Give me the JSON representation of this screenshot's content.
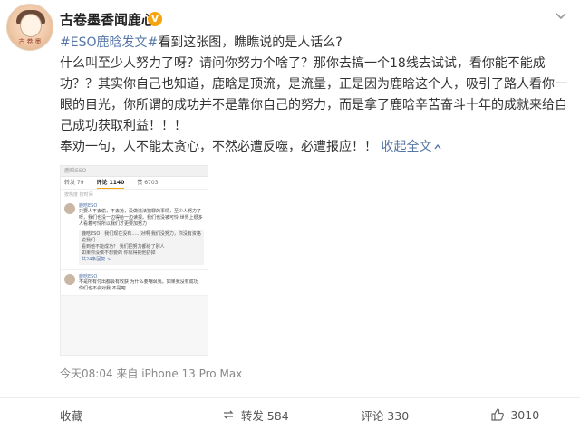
{
  "header": {
    "username": "古卷墨香闻鹿心",
    "verified_mark": "V",
    "avatar_seal": "古卷墨"
  },
  "post": {
    "topic": "#ESO鹿晗发文#",
    "lines": [
      "看到这张图，瞧瞧说的是人话么?",
      "什么叫至少人努力了呀？请问你努力个啥了？那你去搞一个18线去试试，看你能不能成功？？其实你自己也知道，鹿晗是顶流，是流量，正是因为鹿晗这个人，吸引了路人看你一眼的目光，你所谓的成功并不是靠你自己的努力，而是拿了鹿晗辛苦奋斗十年的成就来给自己成功获取利益！！！",
      "奉劝一句，人不能太贪心，不然必遭反噬，必遭报应！！"
    ],
    "expand_label": "收起全文",
    "expand_icon": "chevron-up-icon"
  },
  "embed": {
    "top_bar": "鹿晗ESO",
    "stats": [
      "转发 79",
      "评论 1140",
      "赞 6703"
    ],
    "sub": "按热度 按时间",
    "comments": [
      {
        "name": "鹿晗ESO",
        "body": "只要人不去偷，不去抢，没做违法犯罪的事情，至少人努力了呀，我们也没一边得给一边读报。我们也没被可怜 世界上很多人看着可怜所以我们才更要加努力",
        "replies": [
          "鹿晗ESO：我们现在没有……对啊 我们没努力，你没有资格说我们",
          "看到他不能成功？ 我们把努力都给了别人",
          "如果你没做不想要的 你就得把他扔掉"
        ],
        "link": "共24条回复 >"
      },
      {
        "name": "鹿晗ESO",
        "body": "不是所有付出都会有收获 为什么要嘲讽我，如果我没有成功 你们也不会对我 不是吧",
        "replies": [],
        "link": ""
      }
    ]
  },
  "meta": {
    "time_source": "今天08:04  来自 iPhone 13 Pro Max"
  },
  "actions": {
    "favorite_label": "收藏",
    "repost_label": "转发 584",
    "comment_label": "评论 330",
    "like_label": "3010"
  },
  "colors": {
    "link": "#5576a6",
    "badge": "#f7a30e",
    "text": "#333333",
    "meta": "#888888"
  }
}
